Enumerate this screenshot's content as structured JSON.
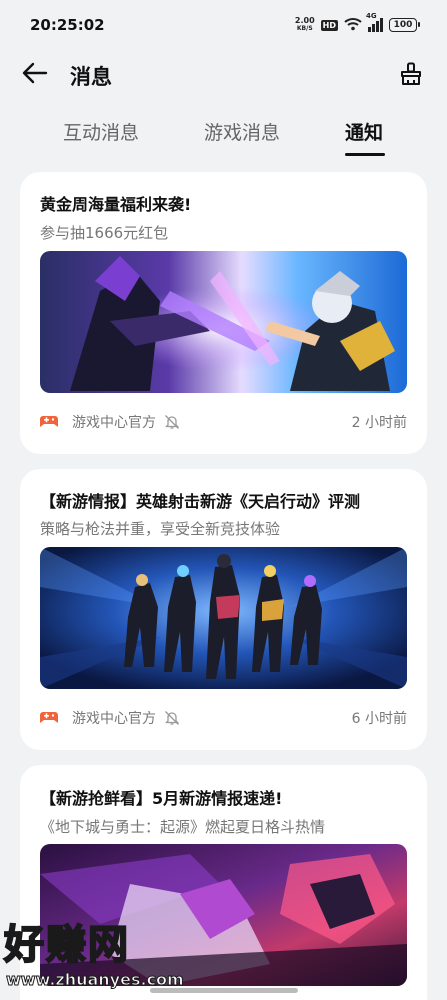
{
  "status": {
    "time": "20:25:02",
    "net_speed_value": "2.00",
    "net_speed_unit": "KB/S",
    "hd": "HD",
    "network": "4G",
    "battery": "100"
  },
  "header": {
    "title": "消息",
    "back_icon": "arrow-left-icon",
    "action_icon": "clean-brush-icon"
  },
  "tabs": [
    {
      "label": "互动消息",
      "active": false
    },
    {
      "label": "游戏消息",
      "active": false
    },
    {
      "label": "通知",
      "active": true
    }
  ],
  "notifications": [
    {
      "title": "黄金周海量福利来袭!",
      "subtitle": "参与抽1666元红包",
      "image": "game-artwork-character-battle",
      "source": "游戏中心官方",
      "time": "2 小时前"
    },
    {
      "title": "【新游情报】英雄射击新游《天启行动》评测",
      "subtitle": "策略与枪法并重，享受全新竞技体验",
      "image": "game-artwork-five-heroes",
      "source": "游戏中心官方",
      "time": "6 小时前"
    },
    {
      "title": "【新游抢鲜看】5月新游情报速递!",
      "subtitle": "《地下城与勇士：起源》燃起夏日格斗热情",
      "image": "game-artwork-fighter",
      "source": "",
      "time": ""
    }
  ],
  "watermark": {
    "text": "好赚网",
    "url": "www.zhuanyes.com"
  },
  "colors": {
    "background": "#f1f2f4",
    "card": "#ffffff",
    "source_icon": "#f0643c"
  }
}
